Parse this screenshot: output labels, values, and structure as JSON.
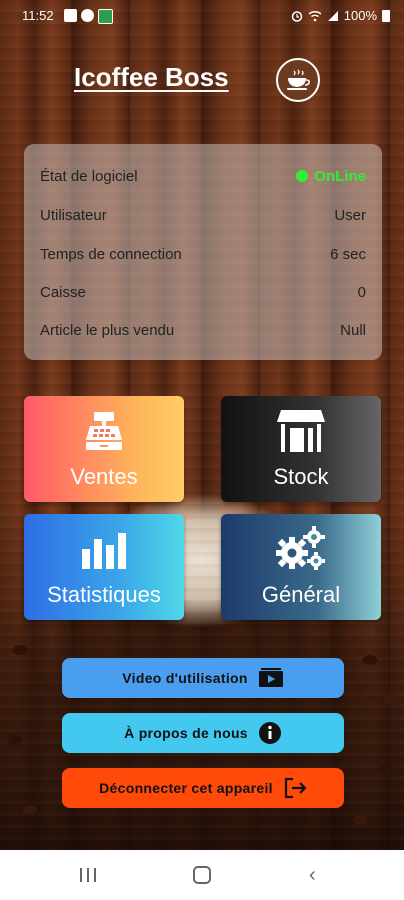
{
  "status_bar": {
    "time": "11:52",
    "battery": "100%"
  },
  "header": {
    "title": "Icoffee Boss",
    "logo_icon": "coffee-cup-icon"
  },
  "info": {
    "rows": [
      {
        "label": "État de logiciel",
        "value": "OnLine"
      },
      {
        "label": "Utilisateur",
        "value": "User"
      },
      {
        "label": "Temps de connection",
        "value": "6 sec"
      },
      {
        "label": "Caisse",
        "value": "0"
      },
      {
        "label": "Article le plus vendu",
        "value": "Null"
      }
    ],
    "online_color": "#33ee33"
  },
  "tiles": {
    "ventes": {
      "label": "Ventes",
      "icon": "cash-register-icon"
    },
    "stock": {
      "label": "Stock",
      "icon": "store-icon"
    },
    "stats": {
      "label": "Statistiques",
      "icon": "bar-chart-icon"
    },
    "general": {
      "label": "Général",
      "icon": "gears-icon"
    }
  },
  "buttons": {
    "video": {
      "label": "Video d'utilisation",
      "icon": "video-icon",
      "color": "#4a9eef"
    },
    "about": {
      "label": "À propos de nous",
      "icon": "info-icon",
      "color": "#43c8f0"
    },
    "logout": {
      "label": "Déconnecter cet appareil",
      "icon": "logout-icon",
      "color": "#ff4a0a"
    }
  }
}
